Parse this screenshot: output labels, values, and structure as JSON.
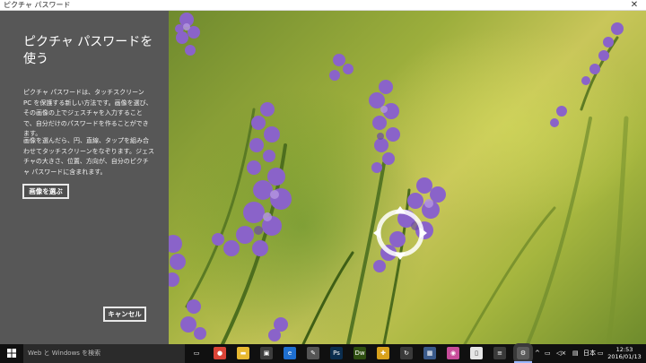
{
  "window": {
    "title": "ピクチャ パスワード",
    "close_glyph": "✕"
  },
  "panel": {
    "heading": "ピクチャ パスワードを使う",
    "paragraph1": "ピクチャ パスワードは、タッチスクリーン PC を保護する新しい方法です。画像を選び、その画像の上でジェスチャを入力することで、自分だけのパスワードを作ることができます。",
    "paragraph2": "画像を選んだら、円、直線、タップを組み合わせてタッチスクリーンをなぞります。ジェスチャの大きさ、位置、方向が、自分のピクチャ パスワードに含まれます。",
    "choose_picture_label": "画像を選ぶ",
    "cancel_label": "キャンセル"
  },
  "taskbar": {
    "search_placeholder": "Web と Windows を検索",
    "apps": [
      {
        "name": "task-view-icon",
        "glyph": "▭",
        "color": "#101010"
      },
      {
        "name": "chrome-icon",
        "glyph": "●",
        "color": "#db4437"
      },
      {
        "name": "file-explorer-icon",
        "glyph": "▬",
        "color": "#e8b931"
      },
      {
        "name": "store-icon",
        "glyph": "▣",
        "color": "#3d3d3d"
      },
      {
        "name": "edge-icon",
        "glyph": "e",
        "color": "#1e6fd0"
      },
      {
        "name": "app-icon",
        "glyph": "✎",
        "color": "#555555"
      },
      {
        "name": "photoshop-icon",
        "glyph": "Ps",
        "color": "#0b2d4e"
      },
      {
        "name": "dreamweaver-icon",
        "glyph": "Dw",
        "color": "#2f4f12"
      },
      {
        "name": "puzzle-app-icon",
        "glyph": "✚",
        "color": "#d9a21c"
      },
      {
        "name": "refresh-app-icon",
        "glyph": "↻",
        "color": "#3a3a3a"
      },
      {
        "name": "photos-app-icon",
        "glyph": "▦",
        "color": "#3a5a8a"
      },
      {
        "name": "media-app-icon",
        "glyph": "◉",
        "color": "#c84c9a"
      },
      {
        "name": "document-app-icon",
        "glyph": "▯",
        "color": "#e6e6e6"
      },
      {
        "name": "notes-app-icon",
        "glyph": "≡",
        "color": "#3a3a3a"
      },
      {
        "name": "settings-icon",
        "glyph": "⚙",
        "color": "#5a5a5a"
      }
    ],
    "tray": {
      "chevron": "^",
      "network": "▭",
      "volume": "◁×",
      "message": "▤",
      "ime": "日本",
      "keyboard": "▭"
    },
    "clock_time": "12:53",
    "clock_date": "2016/01/13"
  },
  "colors": {
    "panel_bg": "#575757",
    "taskbar_bg": "#101010",
    "search_bg": "#2b2b2b",
    "accent_active": "#9ab6ff"
  }
}
